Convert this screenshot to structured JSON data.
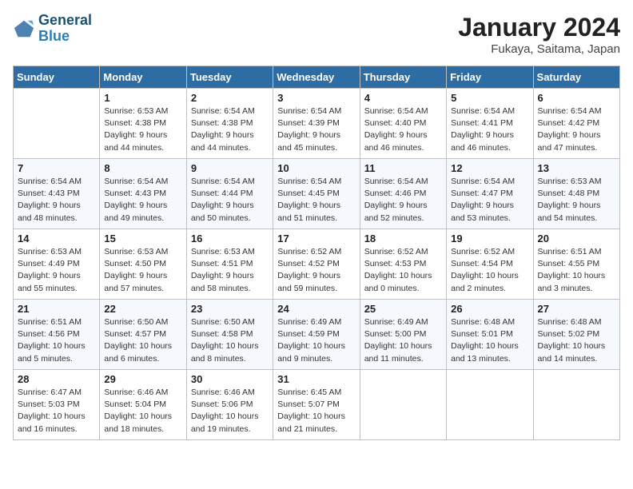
{
  "header": {
    "logo_line1": "General",
    "logo_line2": "Blue",
    "title": "January 2024",
    "subtitle": "Fukaya, Saitama, Japan"
  },
  "weekdays": [
    "Sunday",
    "Monday",
    "Tuesday",
    "Wednesday",
    "Thursday",
    "Friday",
    "Saturday"
  ],
  "weeks": [
    [
      {
        "day": "",
        "info": ""
      },
      {
        "day": "1",
        "info": "Sunrise: 6:53 AM\nSunset: 4:38 PM\nDaylight: 9 hours\nand 44 minutes."
      },
      {
        "day": "2",
        "info": "Sunrise: 6:54 AM\nSunset: 4:38 PM\nDaylight: 9 hours\nand 44 minutes."
      },
      {
        "day": "3",
        "info": "Sunrise: 6:54 AM\nSunset: 4:39 PM\nDaylight: 9 hours\nand 45 minutes."
      },
      {
        "day": "4",
        "info": "Sunrise: 6:54 AM\nSunset: 4:40 PM\nDaylight: 9 hours\nand 46 minutes."
      },
      {
        "day": "5",
        "info": "Sunrise: 6:54 AM\nSunset: 4:41 PM\nDaylight: 9 hours\nand 46 minutes."
      },
      {
        "day": "6",
        "info": "Sunrise: 6:54 AM\nSunset: 4:42 PM\nDaylight: 9 hours\nand 47 minutes."
      }
    ],
    [
      {
        "day": "7",
        "info": "Sunrise: 6:54 AM\nSunset: 4:43 PM\nDaylight: 9 hours\nand 48 minutes."
      },
      {
        "day": "8",
        "info": "Sunrise: 6:54 AM\nSunset: 4:43 PM\nDaylight: 9 hours\nand 49 minutes."
      },
      {
        "day": "9",
        "info": "Sunrise: 6:54 AM\nSunset: 4:44 PM\nDaylight: 9 hours\nand 50 minutes."
      },
      {
        "day": "10",
        "info": "Sunrise: 6:54 AM\nSunset: 4:45 PM\nDaylight: 9 hours\nand 51 minutes."
      },
      {
        "day": "11",
        "info": "Sunrise: 6:54 AM\nSunset: 4:46 PM\nDaylight: 9 hours\nand 52 minutes."
      },
      {
        "day": "12",
        "info": "Sunrise: 6:54 AM\nSunset: 4:47 PM\nDaylight: 9 hours\nand 53 minutes."
      },
      {
        "day": "13",
        "info": "Sunrise: 6:53 AM\nSunset: 4:48 PM\nDaylight: 9 hours\nand 54 minutes."
      }
    ],
    [
      {
        "day": "14",
        "info": "Sunrise: 6:53 AM\nSunset: 4:49 PM\nDaylight: 9 hours\nand 55 minutes."
      },
      {
        "day": "15",
        "info": "Sunrise: 6:53 AM\nSunset: 4:50 PM\nDaylight: 9 hours\nand 57 minutes."
      },
      {
        "day": "16",
        "info": "Sunrise: 6:53 AM\nSunset: 4:51 PM\nDaylight: 9 hours\nand 58 minutes."
      },
      {
        "day": "17",
        "info": "Sunrise: 6:52 AM\nSunset: 4:52 PM\nDaylight: 9 hours\nand 59 minutes."
      },
      {
        "day": "18",
        "info": "Sunrise: 6:52 AM\nSunset: 4:53 PM\nDaylight: 10 hours\nand 0 minutes."
      },
      {
        "day": "19",
        "info": "Sunrise: 6:52 AM\nSunset: 4:54 PM\nDaylight: 10 hours\nand 2 minutes."
      },
      {
        "day": "20",
        "info": "Sunrise: 6:51 AM\nSunset: 4:55 PM\nDaylight: 10 hours\nand 3 minutes."
      }
    ],
    [
      {
        "day": "21",
        "info": "Sunrise: 6:51 AM\nSunset: 4:56 PM\nDaylight: 10 hours\nand 5 minutes."
      },
      {
        "day": "22",
        "info": "Sunrise: 6:50 AM\nSunset: 4:57 PM\nDaylight: 10 hours\nand 6 minutes."
      },
      {
        "day": "23",
        "info": "Sunrise: 6:50 AM\nSunset: 4:58 PM\nDaylight: 10 hours\nand 8 minutes."
      },
      {
        "day": "24",
        "info": "Sunrise: 6:49 AM\nSunset: 4:59 PM\nDaylight: 10 hours\nand 9 minutes."
      },
      {
        "day": "25",
        "info": "Sunrise: 6:49 AM\nSunset: 5:00 PM\nDaylight: 10 hours\nand 11 minutes."
      },
      {
        "day": "26",
        "info": "Sunrise: 6:48 AM\nSunset: 5:01 PM\nDaylight: 10 hours\nand 13 minutes."
      },
      {
        "day": "27",
        "info": "Sunrise: 6:48 AM\nSunset: 5:02 PM\nDaylight: 10 hours\nand 14 minutes."
      }
    ],
    [
      {
        "day": "28",
        "info": "Sunrise: 6:47 AM\nSunset: 5:03 PM\nDaylight: 10 hours\nand 16 minutes."
      },
      {
        "day": "29",
        "info": "Sunrise: 6:46 AM\nSunset: 5:04 PM\nDaylight: 10 hours\nand 18 minutes."
      },
      {
        "day": "30",
        "info": "Sunrise: 6:46 AM\nSunset: 5:06 PM\nDaylight: 10 hours\nand 19 minutes."
      },
      {
        "day": "31",
        "info": "Sunrise: 6:45 AM\nSunset: 5:07 PM\nDaylight: 10 hours\nand 21 minutes."
      },
      {
        "day": "",
        "info": ""
      },
      {
        "day": "",
        "info": ""
      },
      {
        "day": "",
        "info": ""
      }
    ]
  ]
}
